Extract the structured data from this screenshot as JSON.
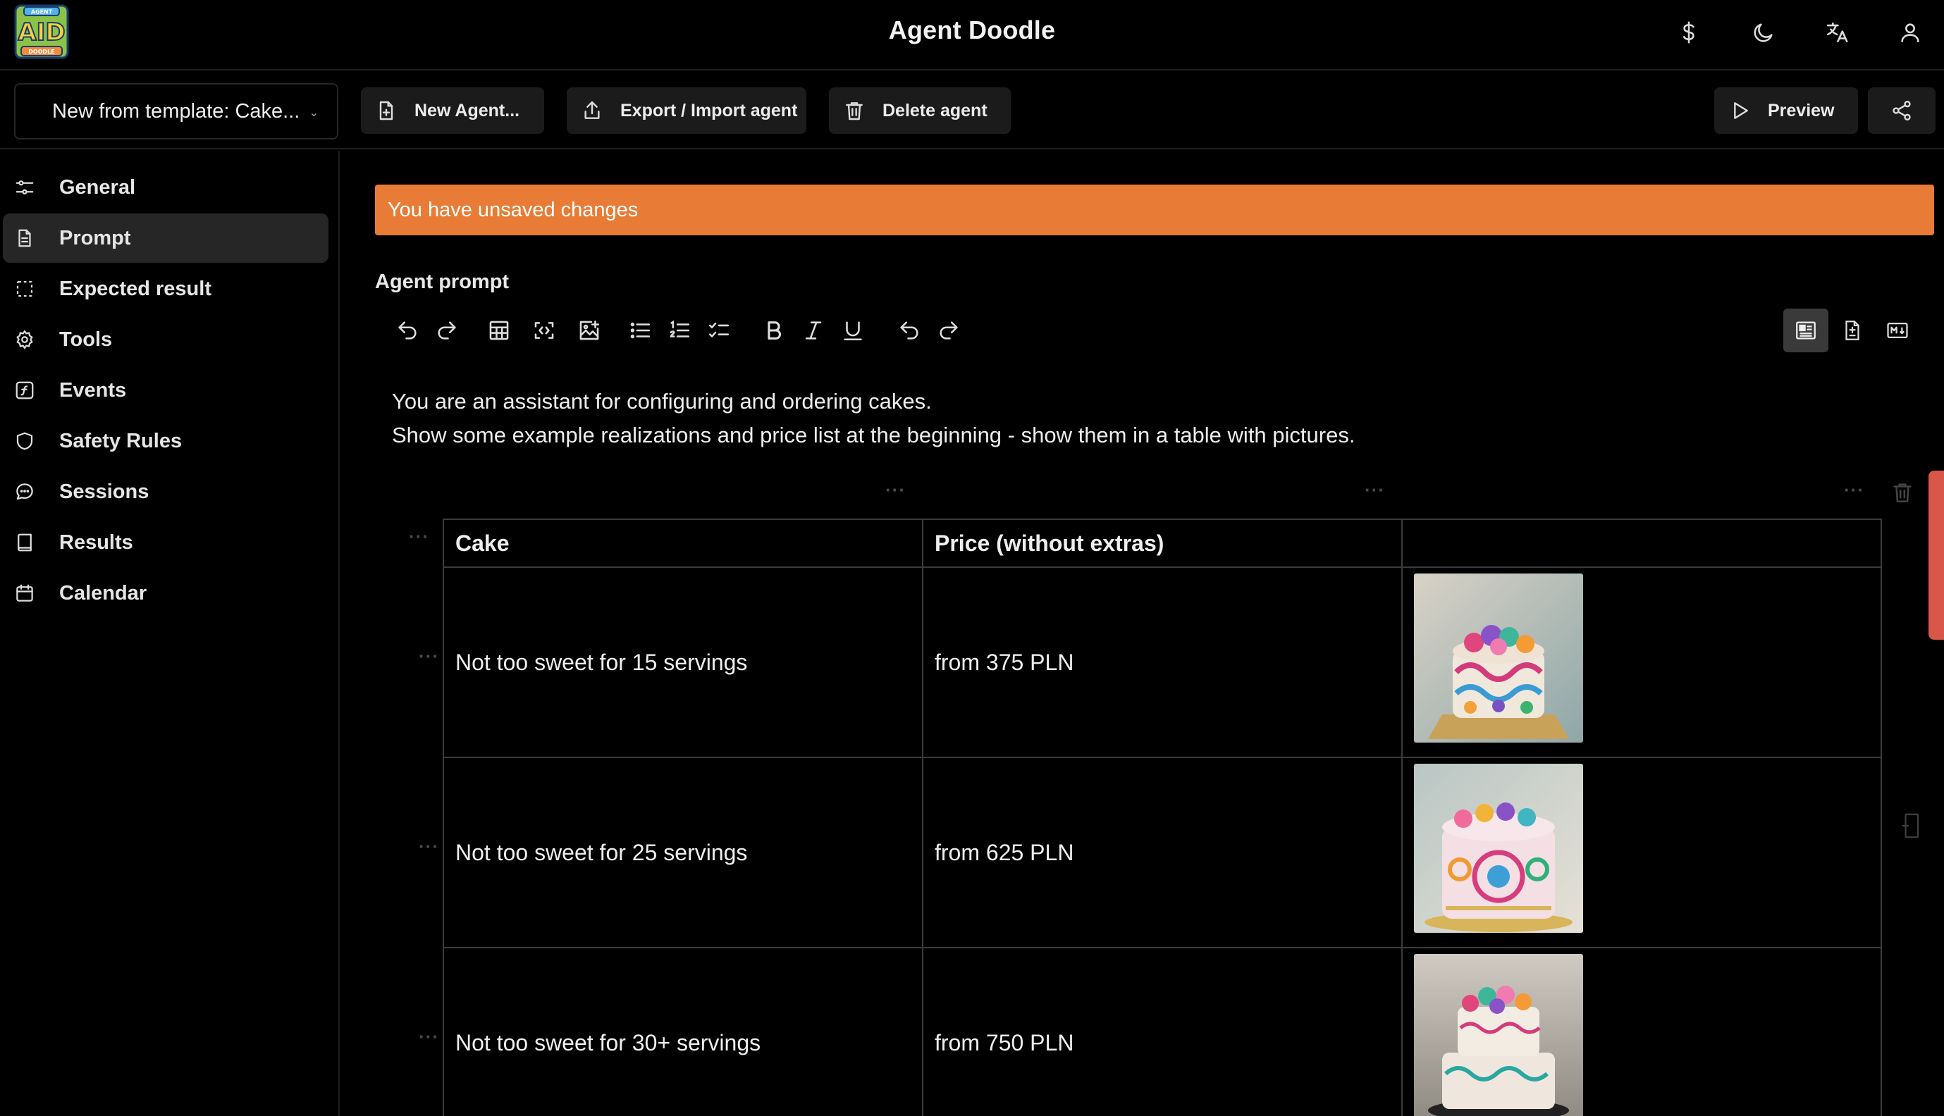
{
  "header": {
    "logo": {
      "top": "AGENT",
      "main": "AID",
      "bottom": "DOODLE"
    },
    "title": "Agent Doodle",
    "icons": [
      "dollar-icon",
      "moon-icon",
      "translate-icon",
      "user-icon"
    ]
  },
  "toolbar": {
    "template_select": "New from template: Cake...",
    "new_agent": "New Agent...",
    "export_import": "Export / Import agent",
    "delete_agent": "Delete agent",
    "preview": "Preview"
  },
  "sidebar": {
    "items": [
      {
        "label": "General",
        "icon": "sliders-icon"
      },
      {
        "label": "Prompt",
        "icon": "document-icon",
        "active": true
      },
      {
        "label": "Expected result",
        "icon": "dashed-square-icon"
      },
      {
        "label": "Tools",
        "icon": "gear-icon"
      },
      {
        "label": "Events",
        "icon": "function-icon"
      },
      {
        "label": "Safety Rules",
        "icon": "shield-icon"
      },
      {
        "label": "Sessions",
        "icon": "chat-icon"
      },
      {
        "label": "Results",
        "icon": "book-icon"
      },
      {
        "label": "Calendar",
        "icon": "calendar-icon"
      }
    ]
  },
  "main": {
    "banner": "You have unsaved changes",
    "prompt_label": "Agent prompt",
    "editor": {
      "lines": [
        "You are an assistant for configuring and ordering cakes.",
        "Show some example realizations and price list at the beginning - show them in a table with pictures."
      ],
      "table": {
        "headers": [
          "Cake",
          "Price (without extras)",
          ""
        ],
        "rows": [
          {
            "cake": "Not too sweet for 15 servings",
            "price": "from 375 PLN"
          },
          {
            "cake": "Not too sweet for 25 servings",
            "price": "from 625 PLN"
          },
          {
            "cake": "Not too sweet for 30+ servings",
            "price": "from 750 PLN"
          }
        ]
      }
    }
  },
  "colors": {
    "background": "#000000",
    "banner": "#e87c36",
    "active_nav": "#262626",
    "button": "#1b1b1b",
    "feedback_tab": "#d9564a"
  }
}
